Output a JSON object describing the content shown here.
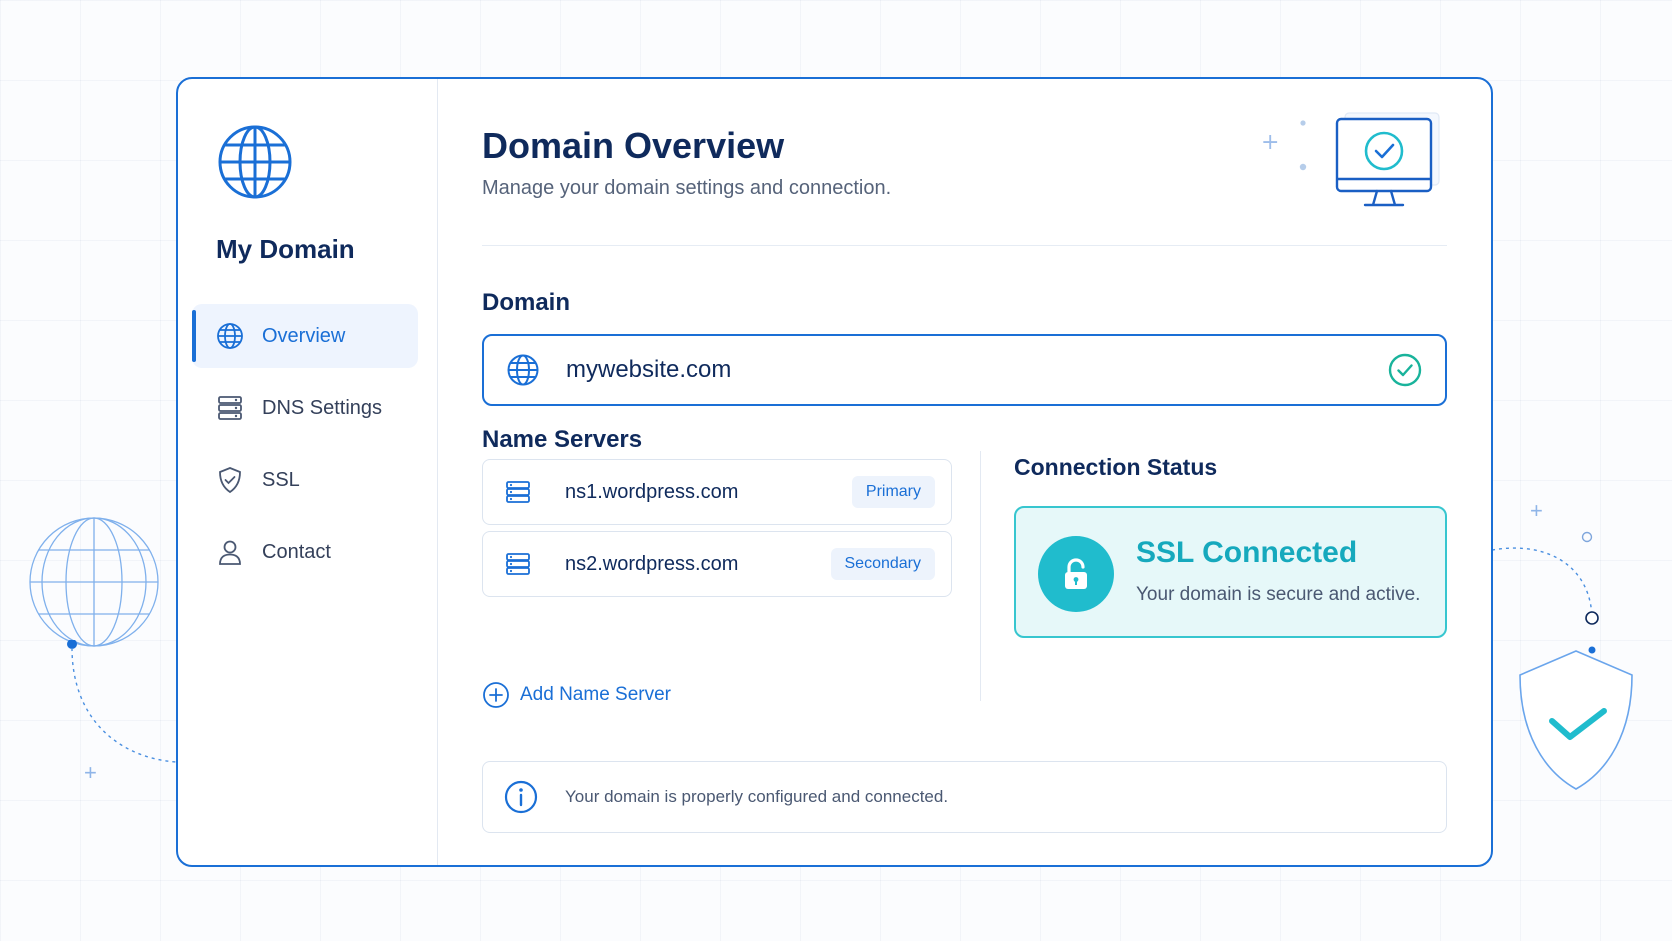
{
  "app": {
    "title": "My Domain"
  },
  "sidebar": {
    "items": [
      {
        "label": "Overview",
        "icon": "globe-icon",
        "active": true
      },
      {
        "label": "DNS Settings",
        "icon": "server-icon",
        "active": false
      },
      {
        "label": "SSL",
        "icon": "shield-icon",
        "active": false
      },
      {
        "label": "Contact",
        "icon": "user-icon",
        "active": false
      }
    ]
  },
  "header": {
    "title": "Domain Overview",
    "subtitle": "Manage your domain settings and connection."
  },
  "domain": {
    "label": "Domain",
    "value": "mywebsite.com",
    "valid": true
  },
  "name_servers": {
    "label": "Name Servers",
    "items": [
      {
        "host": "ns1.wordpress.com",
        "badge": "Primary"
      },
      {
        "host": "ns2.wordpress.com",
        "badge": "Secondary"
      }
    ],
    "add_label": "Add Name Server"
  },
  "connection": {
    "label": "Connection Status",
    "status_title": "SSL Connected",
    "status_desc": "Your domain is secure and active."
  },
  "info": {
    "message": "Your domain is properly configured and connected."
  },
  "colors": {
    "accent": "#1a6fd6",
    "navy": "#0f2a5c",
    "teal": "#20bccd",
    "success": "#19b39b"
  }
}
